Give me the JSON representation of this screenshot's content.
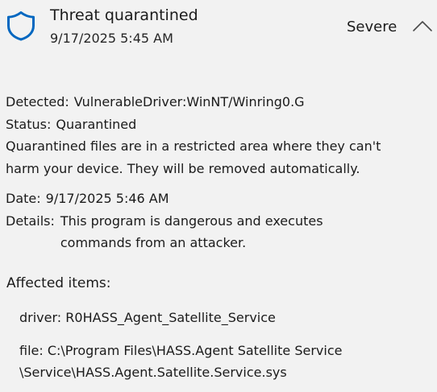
{
  "header": {
    "icon": "shield-icon",
    "title": "Threat quarantined",
    "timestamp": "9/17/2025 5:45 AM",
    "severity": "Severe",
    "toggle_icon": "chevron-up-icon"
  },
  "details": {
    "detected_label": "Detected:",
    "detected_value": "VulnerableDriver:WinNT/Winring0.G",
    "status_label": "Status:",
    "status_value": "Quarantined",
    "status_description_line1": "Quarantined files are in a restricted area where they can't",
    "status_description_line2": "harm your device. They will be removed automatically.",
    "date_label": "Date:",
    "date_value": "9/17/2025 5:46 AM",
    "details_label": "Details:",
    "details_value_line1": "This program is dangerous and executes",
    "details_value_line2": "commands from an attacker."
  },
  "affected": {
    "heading": "Affected items:",
    "items": [
      {
        "line1": "driver: R0HASS_Agent_Satellite_Service"
      },
      {
        "line1": "file: C:\\Program Files\\HASS.Agent Satellite Service",
        "line2": "\\Service\\HASS.Agent.Satellite.Service.sys"
      }
    ]
  },
  "colors": {
    "background": "#f2f2f2",
    "text": "#1b1b1b",
    "shield_accent": "#0067c0"
  }
}
